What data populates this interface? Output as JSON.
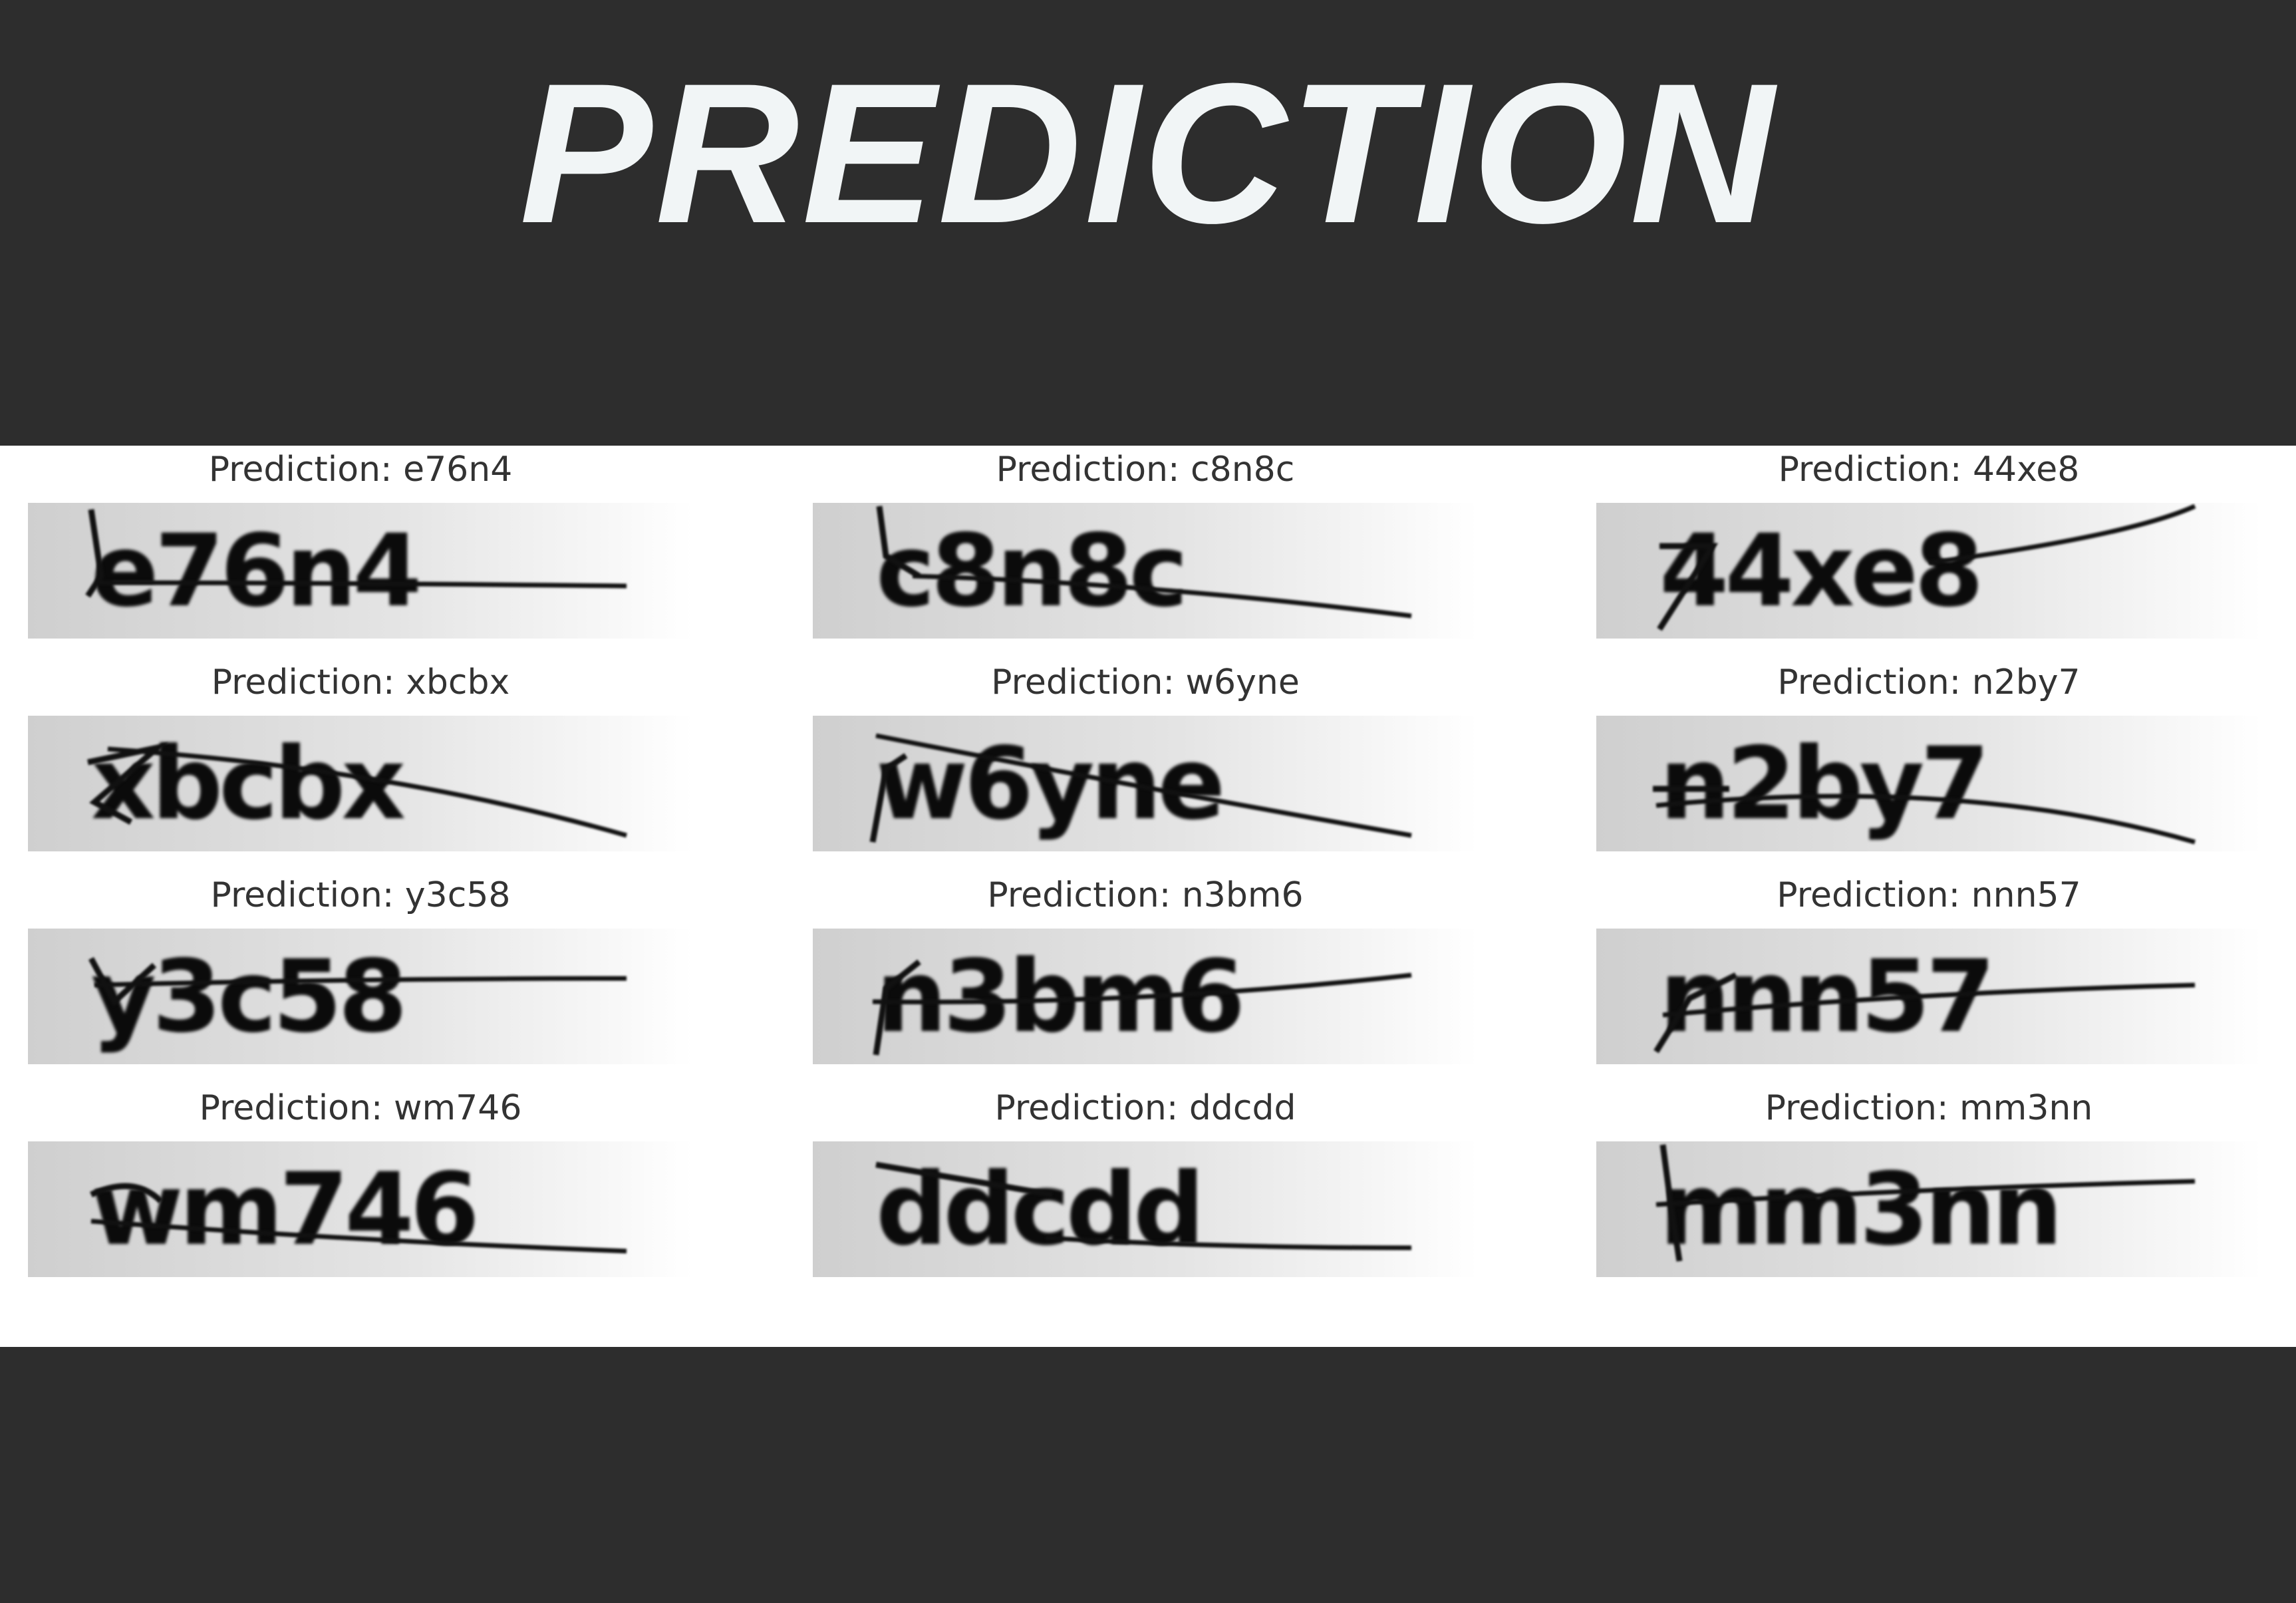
{
  "title": "PREDICTION",
  "predictions": [
    {
      "label": "Prediction: e76n4",
      "captcha": "e76n4"
    },
    {
      "label": "Prediction: c8n8c",
      "captcha": "c8n8c"
    },
    {
      "label": "Prediction: 44xe8",
      "captcha": "44xe8"
    },
    {
      "label": "Prediction: xbcbx",
      "captcha": "xbcbx"
    },
    {
      "label": "Prediction: w6yne",
      "captcha": "w6yne"
    },
    {
      "label": "Prediction: n2by7",
      "captcha": "n2by7"
    },
    {
      "label": "Prediction: y3c58",
      "captcha": "y3c58"
    },
    {
      "label": "Prediction: n3bm6",
      "captcha": "n3bm6"
    },
    {
      "label": "Prediction: nnn57",
      "captcha": "nnn57"
    },
    {
      "label": "Prediction: wm746",
      "captcha": "wm746"
    },
    {
      "label": "Prediction: ddcdd",
      "captcha": "ddcdd"
    },
    {
      "label": "Prediction: mm3nn",
      "captcha": "mm3nn"
    }
  ]
}
